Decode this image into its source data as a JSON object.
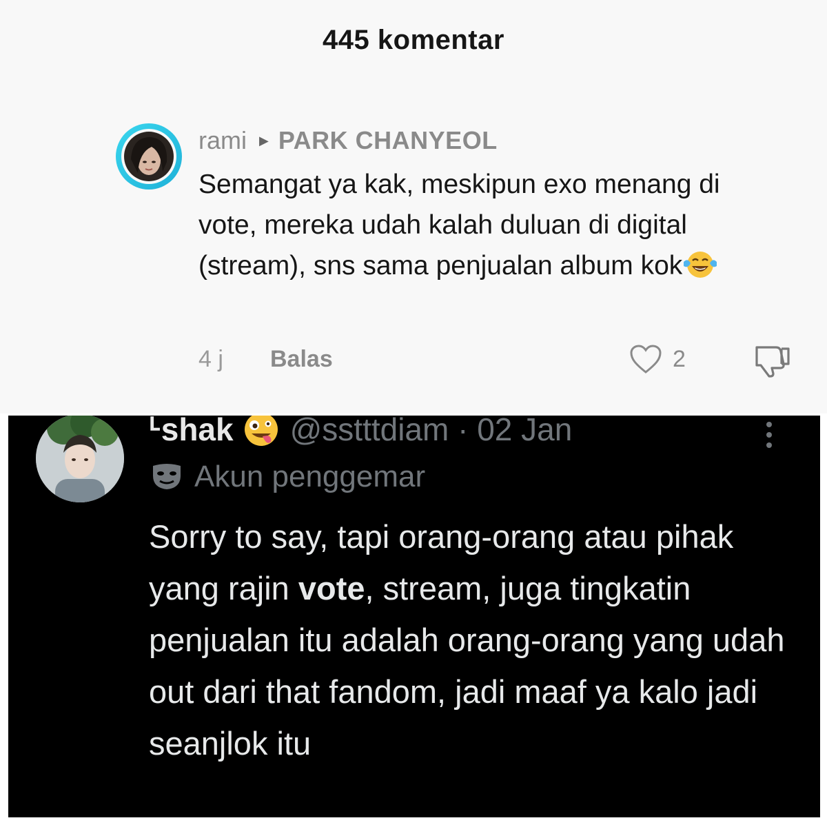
{
  "tiktok": {
    "comment_count": "445 komentar",
    "comment": {
      "author": "rami",
      "reply_to": "PARK CHANYEOL",
      "text": "Semangat ya kak, meskipun exo menang di vote, mereka udah kalah duluan di digital (stream), sns sama penjualan album kok",
      "emoji": "tears-of-joy-emoji",
      "time": "4 j",
      "reply_label": "Balas",
      "like_count": "2"
    },
    "colors": {
      "avatar_ring": "#3ad6ee",
      "muted": "#8a8a8a"
    }
  },
  "twitter": {
    "display_name": "ᒻshak",
    "name_emoji": "zany-face-emoji",
    "handle_date": "@sstttdiam · 02 Jan",
    "badge": "Akun penggemar",
    "body_parts": {
      "before_bold": "Sorry to say, tapi orang-orang atau pihak yang rajin ",
      "bold": "vote",
      "after_bold": ", stream, juga tingkatin penjualan itu adalah orang-orang yang udah out dari that fandom, jadi maaf ya kalo jadi seanjlok itu"
    },
    "colors": {
      "background": "#000000",
      "secondary_text": "#71767b"
    }
  }
}
